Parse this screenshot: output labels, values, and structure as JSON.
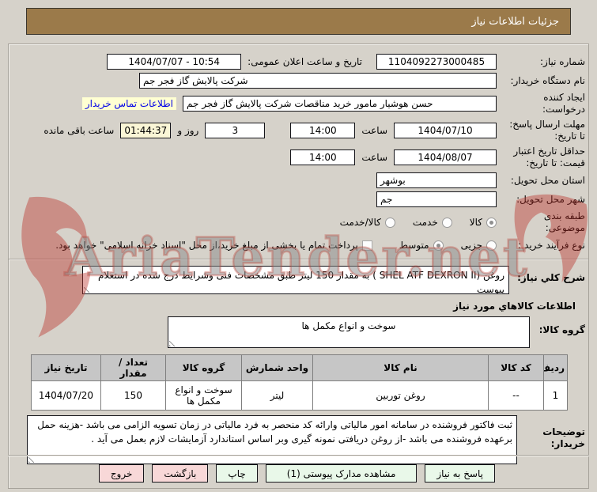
{
  "title": "جزئیات اطلاعات نیاز",
  "watermark": "AriaTender.net",
  "colors": {
    "titlebar": "#9b7a4a",
    "link_blue": "#0000e8",
    "link_highlight": "#ffffd2",
    "countdown_bg": "#faf6d6",
    "table_header_bg": "#c6c6c6",
    "button_green": "#e9f8e9",
    "button_pink": "#f8d8d8",
    "watermark_red": "#be3e32"
  },
  "fields": {
    "need_number_label": "شماره نیاز:",
    "need_number": "1104092273000485",
    "announce_label": "تاریخ و ساعت اعلان عمومی:",
    "announce_value": "1404/07/07 - 10:54",
    "buyer_org_label": "نام دستگاه خریدار:",
    "buyer_org": "شرکت پالایش گاز فجر جم",
    "creator_label": "ایجاد کننده درخواست:",
    "creator": "حسن هوشیار مامور خرید مناقصات شرکت پالایش گاز فجر جم",
    "contact_link": "اطلاعات تماس خریدار",
    "deadline_label": "مهلت ارسال پاسخ: تا تاریخ:",
    "deadline_date": "1404/07/10",
    "hour_label": "ساعت",
    "deadline_time": "14:00",
    "days_value": "3",
    "days_suffix": "روز و",
    "countdown": "01:44:37",
    "countdown_suffix": "ساعت باقی مانده",
    "validity_label": "حداقل تاریخ اعتبار قیمت: تا تاریخ:",
    "validity_date": "1404/08/07",
    "validity_time": "14:00",
    "province_label": "استان محل تحویل:",
    "province": "بوشهر",
    "city_label": "شهر محل تحویل:",
    "city": "جم",
    "category": {
      "label": "طبقه بندی موضوعی:",
      "options": [
        "کالا",
        "خدمت",
        "کالا/خدمت"
      ],
      "selected": "کالا"
    },
    "process": {
      "label": "نوع فرآیند خرید :",
      "options": [
        "جزیی",
        "متوسط"
      ],
      "selected": "متوسط",
      "treasury_note": "پرداخت تمام یا بخشی از مبلغ خرید،از محل \"اسناد خزانه اسلامی\" خواهد بود.",
      "treasury_checked": false
    }
  },
  "need_description": {
    "label": "شرح كلي نياز:",
    "text": "روغن (SHEL ATF DEXRON  II ) به مقدار 150 لیتر طبق مشخصات فنی وشرایط درج شده در استعلام پیوست"
  },
  "goods_section": {
    "header": "اطلاعات كالاهاي مورد نياز",
    "group_label": "گروه کالا:",
    "group_value": "سوخت و انواع مکمل ها"
  },
  "table": {
    "headers": [
      "ردیف",
      "کد کالا",
      "نام کالا",
      "واحد شمارش",
      "گروه کالا",
      "تعداد / مقدار",
      "تاریخ نیاز"
    ],
    "rows": [
      [
        "1",
        "--",
        "روغن توربین",
        "لیتر",
        "سوخت و انواع مکمل ها",
        "150",
        "1404/07/20"
      ]
    ]
  },
  "buyer_notes": {
    "label": "توضیحات خریدار:",
    "text": "ثبت فاکتور فروشنده در سامانه امور مالیاتی وارائه کد منحصر به فرد مالیاتی در زمان تسویه الزامی می باشد -هزینه حمل برعهده فروشنده می باشد -از روغن دریافتی نمونه گیری وبر اساس استاندارد آزمایشات لازم بعمل می آید ."
  },
  "buttons": {
    "respond": "پاسخ به نیاز",
    "view_attachments": "مشاهده مدارک پیوستی (1)",
    "print": "چاپ",
    "back": "بازگشت",
    "exit": "خروج"
  }
}
